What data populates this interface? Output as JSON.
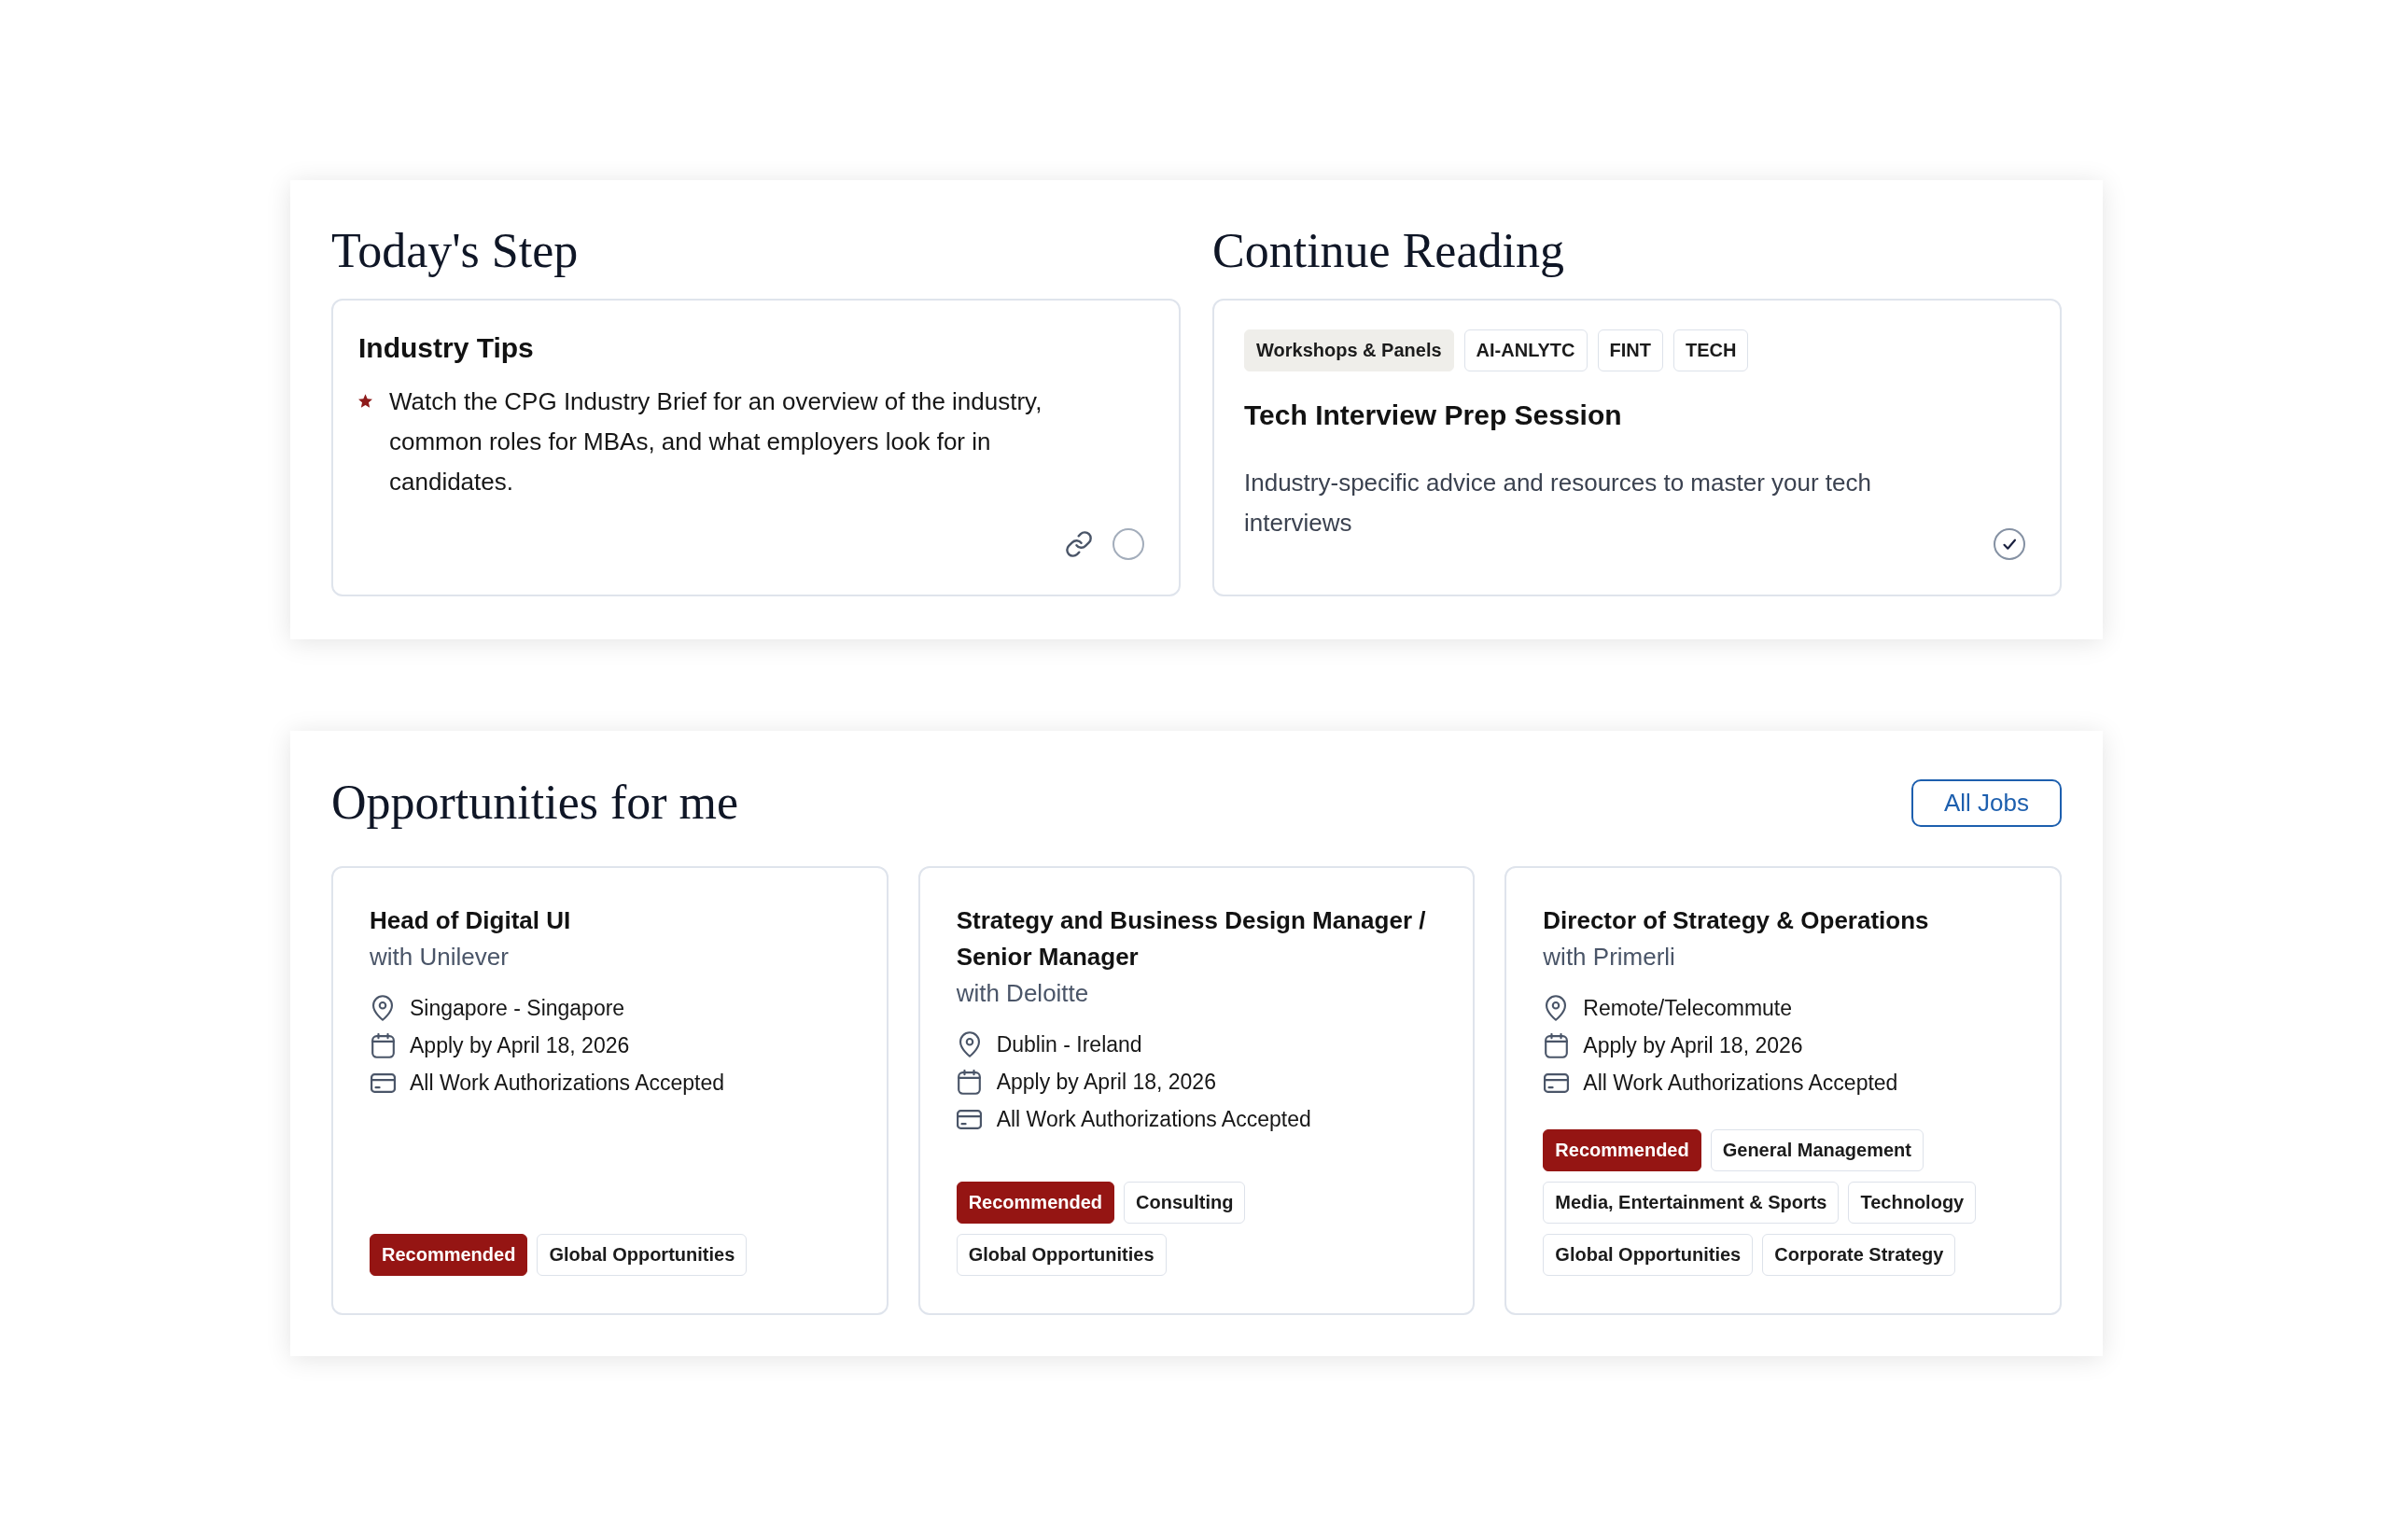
{
  "todays_step": {
    "title": "Today's Step",
    "card": {
      "title": "Industry Tips",
      "tip": "Watch the CPG Industry Brief for an overview of the industry, common roles for MBAs, and what employers look for in candidates.",
      "completed": false
    }
  },
  "continue_reading": {
    "title": "Continue Reading",
    "card": {
      "tags": [
        {
          "label": "Workshops & Panels",
          "kind": "category"
        },
        {
          "label": "AI-ANLYTC",
          "kind": "plain"
        },
        {
          "label": "FINT",
          "kind": "plain"
        },
        {
          "label": "TECH",
          "kind": "plain"
        }
      ],
      "title": "Tech Interview Prep Session",
      "description": "Industry-specific advice and resources to master your tech interviews",
      "completed": true
    }
  },
  "opportunities": {
    "title": "Opportunities for me",
    "all_jobs_button": "All Jobs",
    "jobs": [
      {
        "title": "Head of Digital UI",
        "company": "with Unilever",
        "details": [
          {
            "kind": "location",
            "text": "Singapore - Singapore"
          },
          {
            "kind": "deadline",
            "text": "Apply by April 18, 2026"
          },
          {
            "kind": "work_authorization",
            "text": "All Work Authorizations Accepted"
          }
        ],
        "tags": [
          {
            "label": "Recommended",
            "kind": "recommended"
          },
          {
            "label": "Global Opportunities",
            "kind": "plain"
          }
        ]
      },
      {
        "title": "Strategy and Business Design Manager / Senior Manager",
        "company": "with Deloitte",
        "details": [
          {
            "kind": "location",
            "text": "Dublin - Ireland"
          },
          {
            "kind": "deadline",
            "text": "Apply by April 18, 2026"
          },
          {
            "kind": "work_authorization",
            "text": "All Work Authorizations Accepted"
          }
        ],
        "tags": [
          {
            "label": "Recommended",
            "kind": "recommended"
          },
          {
            "label": "Consulting",
            "kind": "plain"
          },
          {
            "label": "Global Opportunities",
            "kind": "plain"
          }
        ]
      },
      {
        "title": "Director of Strategy & Operations",
        "company": "with Primerli",
        "details": [
          {
            "kind": "location",
            "text": "Remote/Telecommute"
          },
          {
            "kind": "deadline",
            "text": "Apply by April 18, 2026"
          },
          {
            "kind": "work_authorization",
            "text": "All Work Authorizations Accepted"
          }
        ],
        "tags": [
          {
            "label": "Recommended",
            "kind": "recommended"
          },
          {
            "label": "General Management",
            "kind": "plain"
          },
          {
            "label": "Media, Entertainment & Sports",
            "kind": "plain"
          },
          {
            "label": "Technology",
            "kind": "plain"
          },
          {
            "label": "Global Opportunities",
            "kind": "plain"
          },
          {
            "label": "Corporate Strategy",
            "kind": "plain"
          }
        ]
      }
    ]
  }
}
